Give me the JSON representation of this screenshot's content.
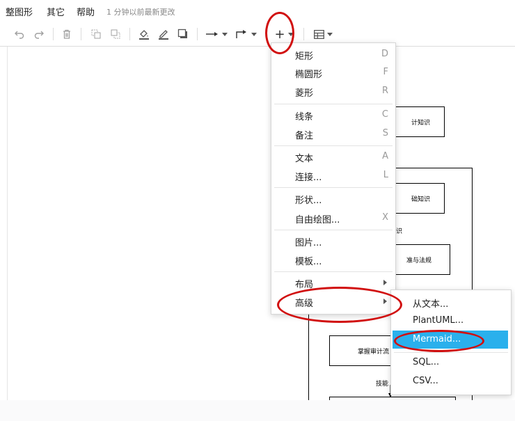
{
  "menubar": {
    "items": [
      "整图形",
      "其它",
      "帮助"
    ],
    "status": "1 分钟以前最新更改"
  },
  "toolbar": {
    "icons": [
      "undo-icon",
      "redo-icon",
      "delete-icon",
      "to-front-icon",
      "to-back-icon",
      "fill-color-icon",
      "line-color-icon",
      "shadow-icon",
      "connection-icon",
      "waypoints-icon",
      "insert-icon",
      "table-icon"
    ],
    "insert_symbol": "+"
  },
  "insert_menu": {
    "groups": [
      [
        {
          "label": "矩形",
          "shortcut": "D"
        },
        {
          "label": "椭圆形",
          "shortcut": "F"
        },
        {
          "label": "菱形",
          "shortcut": "R"
        }
      ],
      [
        {
          "label": "线条",
          "shortcut": "C"
        },
        {
          "label": "备注",
          "shortcut": "S"
        }
      ],
      [
        {
          "label": "文本",
          "shortcut": "A"
        },
        {
          "label": "连接...",
          "shortcut": "L"
        }
      ],
      [
        {
          "label": "形状...",
          "shortcut": ""
        },
        {
          "label": "自由绘图...",
          "shortcut": "X"
        }
      ],
      [
        {
          "label": "图片...",
          "shortcut": ""
        },
        {
          "label": "模板...",
          "shortcut": ""
        }
      ],
      [
        {
          "label": "布局",
          "shortcut": "",
          "submenu": true
        },
        {
          "label": "高级",
          "shortcut": "",
          "submenu": true
        }
      ]
    ]
  },
  "advanced_menu": {
    "items": [
      {
        "label": "从文本...",
        "highlighted": false
      },
      {
        "label": "PlantUML...",
        "highlighted": false
      },
      {
        "label": "Mermaid...",
        "highlighted": true
      },
      {
        "label": "SQL...",
        "highlighted": false
      },
      {
        "label": "CSV...",
        "highlighted": false
      }
    ]
  },
  "diagram": {
    "texts": [
      "计知识",
      "础知识",
      "识",
      "准与法规",
      "掌握审计流",
      "技能"
    ]
  },
  "colors": {
    "highlight": "#2ab0ec",
    "annotation_red": "#d10f0f"
  }
}
